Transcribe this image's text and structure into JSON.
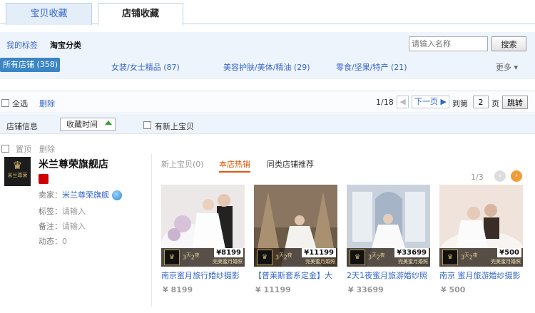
{
  "tabs": [
    {
      "label": "宝贝收藏"
    },
    {
      "label": "店铺收藏"
    }
  ],
  "filter": {
    "my_tags": "我的标签",
    "taobao_category": "淘宝分类",
    "search_placeholder": "请输入名称",
    "search_button": "搜索",
    "active_category": "所有店铺 (358)",
    "categories": [
      "女装/女士精品 (87)",
      "美容护肤/美体/精油 (29)",
      "零食/坚果/特产 (21)"
    ],
    "more": "更多 ▾"
  },
  "actions": {
    "select_all": "全选",
    "delete": "删除",
    "page_info": "1/18",
    "prev": "◀",
    "next": "下一页 ▶",
    "goto_label": "到第",
    "page_value": "2",
    "page_suffix": "页",
    "go_button": "跳转"
  },
  "sort": {
    "shop_info": "店铺信息",
    "collect_time": "收藏时间",
    "new_items": "有新上宝贝"
  },
  "shop": {
    "pin": "置顶",
    "delete": "删除",
    "logo_text": "米兰尊荣",
    "name": "米兰尊荣旗舰店",
    "seller_label": "卖家：",
    "seller_value": "米兰尊荣旗舰",
    "tags_label": "标签：",
    "tags_value": "请输入",
    "notes_label": "备注：",
    "notes_value": "请输入",
    "dynamic_label": "动态：",
    "dynamic_value": "0",
    "inner_tabs": [
      "新上宝贝(0)",
      "本店热销",
      "同类店铺推荐"
    ],
    "pager": "1/3",
    "products": [
      {
        "title": "南京蜜月旅行婚纱摄影",
        "price": "¥ 8199",
        "tag": "¥8199"
      },
      {
        "title": "【普莱斯套系定金】大",
        "price": "¥ 11199",
        "tag": "¥11199"
      },
      {
        "title": "2天1夜蜜月旅游婚纱照",
        "price": "¥ 33699",
        "tag": "¥33699"
      },
      {
        "title": "南京 蜜月旅游婚纱摄影",
        "price": "¥ 500",
        "tag": "¥500"
      }
    ],
    "band_sub": "完美蜜月婚照"
  },
  "colors": {
    "accent": "#3a85c6",
    "link": "#3366cc",
    "hot": "#e25400",
    "soft_bg": "#eef4fb"
  }
}
